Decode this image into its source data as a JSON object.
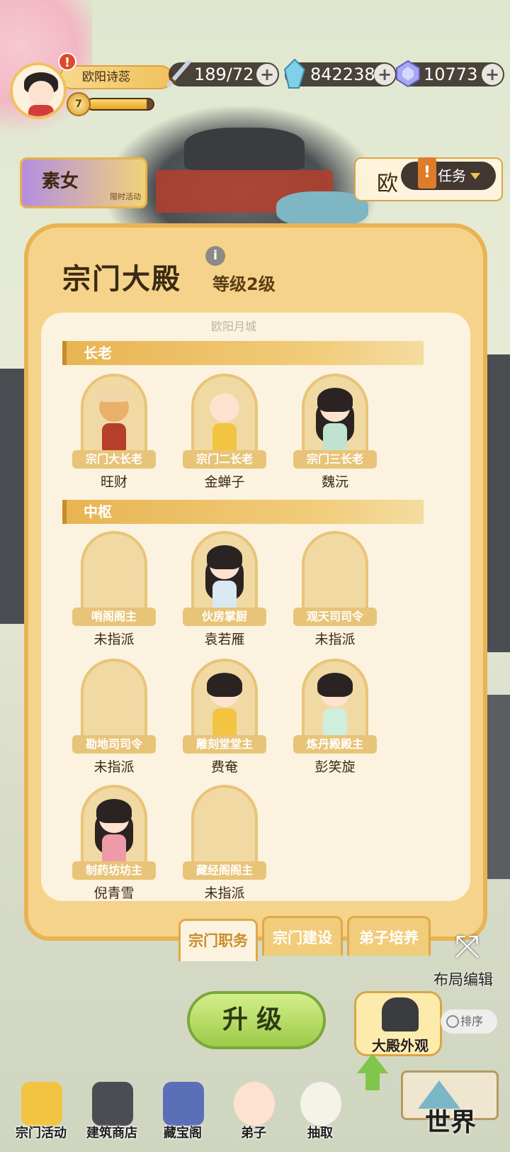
{
  "player": {
    "name": "欧阳诗蕊",
    "level": "7",
    "alert": "!",
    "exp_fraction": 0.9
  },
  "resources": {
    "stamina": "189/72",
    "silver": "842238",
    "jade": "10773",
    "plus": "+"
  },
  "events": {
    "left_title": "素女",
    "left_sub": "限时活动",
    "right_title": "欧",
    "task_label": "任务",
    "task_flag": "!"
  },
  "panel": {
    "title": "宗门大殿",
    "level_text": "等级2级",
    "info": "i",
    "faded": "欧阳月城",
    "sections": {
      "elders": "长老",
      "center": "中枢"
    },
    "elders": [
      {
        "role": "宗门大长老",
        "holder": "旺财"
      },
      {
        "role": "宗门二长老",
        "holder": "金蝉子"
      },
      {
        "role": "宗门三长老",
        "holder": "魏沅"
      }
    ],
    "center": [
      {
        "role": "哨阁阁主",
        "holder": "未指派"
      },
      {
        "role": "伙房掌厨",
        "holder": "袁若雁"
      },
      {
        "role": "观天司司令",
        "holder": "未指派"
      },
      {
        "role": "勘地司司令",
        "holder": "未指派"
      },
      {
        "role": "雕刻堂堂主",
        "holder": "费奄"
      },
      {
        "role": "炼丹殿殿主",
        "holder": "彭笑旋"
      },
      {
        "role": "制药坊坊主",
        "holder": "倪青雪"
      },
      {
        "role": "藏经阁阁主",
        "holder": "未指派"
      }
    ]
  },
  "tabs": [
    "宗门职务",
    "宗门建设",
    "弟子培养"
  ],
  "actions": {
    "upgrade": "升级",
    "appearance": "大殿外观",
    "layout_edit": "布局编辑",
    "layout_icon": "⤧",
    "sort": "排序"
  },
  "nav": [
    "宗门活动",
    "建筑商店",
    "藏宝阁",
    "弟子",
    "抽取"
  ],
  "world": "世界",
  "colors": {
    "panel": "#f6d38a",
    "panel_border": "#e8b452",
    "upgrade_green": "#9dcb4a"
  }
}
